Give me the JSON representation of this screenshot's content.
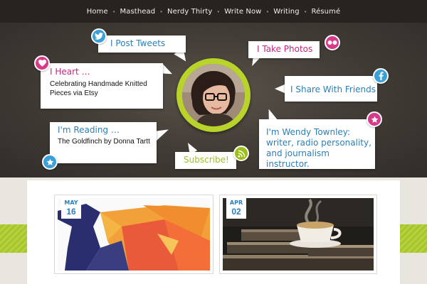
{
  "nav": {
    "items": [
      "Home",
      "Masthead",
      "Nerdy Thirty",
      "Write Now",
      "Writing",
      "Résumé"
    ],
    "separator": "•"
  },
  "hero": {
    "tweets": {
      "title": "I Post Tweets",
      "icon": "twitter-icon"
    },
    "photos": {
      "title": "I Take Photos",
      "icon": "flickr-icon"
    },
    "heart": {
      "title": "I Heart …",
      "body": "Celebrating Handmade Knitted Pieces via Etsy",
      "icon": "heart-icon"
    },
    "share": {
      "title": "I Share With Friends",
      "icon": "facebook-icon"
    },
    "reading": {
      "title": "I'm Reading …",
      "body": "The Goldfinch by Donna Tartt",
      "icon": "star-icon"
    },
    "about": {
      "title": "I'm Wendy Townley: writer, radio personality, and journalism instructor.",
      "icon": "star-icon"
    },
    "subscribe": {
      "title": "Subscribe!",
      "icon": "rss-icon"
    }
  },
  "posts": [
    {
      "month": "MAY",
      "day": "16"
    },
    {
      "month": "APR",
      "day": "02"
    }
  ],
  "colors": {
    "blue": "#2b7fb6",
    "pink": "#c8237d",
    "green": "#9cbf1e",
    "dark": "#2e2a26"
  }
}
